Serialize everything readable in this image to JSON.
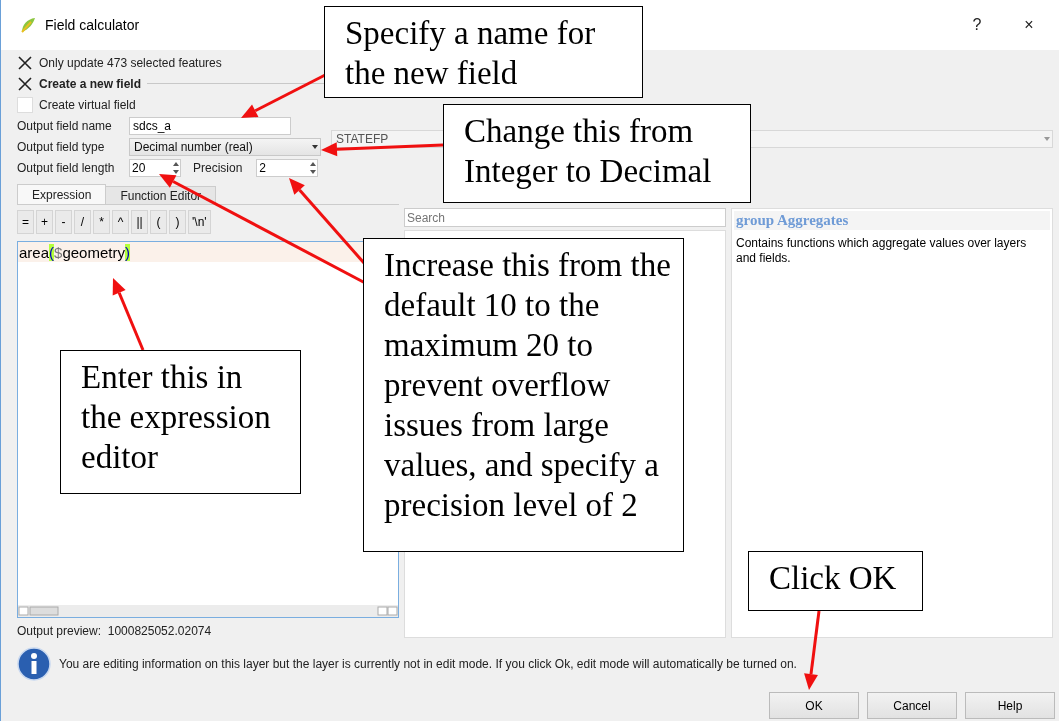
{
  "window": {
    "title": "Field calculator",
    "controls": [
      "?",
      "×"
    ]
  },
  "options": [
    {
      "kind": "checkbox",
      "label": "Only update 473 selected features",
      "checked": true
    },
    {
      "kind": "group",
      "label": "Create a new field",
      "checked": true
    },
    {
      "kind": "checkbox",
      "label": "Create virtual field",
      "checked": false
    }
  ],
  "fields": {
    "name": {
      "label": "Output field name",
      "value": "sdcs_a"
    },
    "type": {
      "label": "Output field type",
      "value": "Decimal number (real)"
    },
    "existing_field": {
      "value": "STATEFP",
      "disabled": true
    },
    "length": {
      "label": "Output field length",
      "value": "20"
    },
    "precision": {
      "label": "Precision",
      "value": "2"
    }
  },
  "tabs": [
    {
      "label": "Expression",
      "selected": true
    },
    {
      "label": "Function Editor",
      "selected": false
    }
  ],
  "operators": [
    "=",
    "+",
    "-",
    "/",
    "*",
    "^",
    "||",
    "(",
    ")",
    "'\\n'"
  ],
  "expression": "area($geometry)",
  "function_search": {
    "placeholder": "Search"
  },
  "help": {
    "title": "group Aggregates",
    "text": "Contains functions which aggregate values over layers and fields."
  },
  "output_preview": {
    "label": "Output preview:",
    "value": "1000825052.02074"
  },
  "message": "You are editing information on this layer but the layer is currently not in edit mode. If you click Ok, edit mode will automatically be turned on.",
  "buttons": [
    {
      "label": "OK"
    },
    {
      "label": "Cancel"
    },
    {
      "label": "Help"
    }
  ],
  "callouts": [
    {
      "text": "Specify a name for the new field"
    },
    {
      "text": "Change this from Integer to Decimal"
    },
    {
      "text": "Increase this from the default 10 to the maximum 20 to prevent overflow issues from large values, and specify a precision level of 2"
    },
    {
      "text": "Enter this in the expression editor"
    },
    {
      "text": "Click OK"
    }
  ]
}
